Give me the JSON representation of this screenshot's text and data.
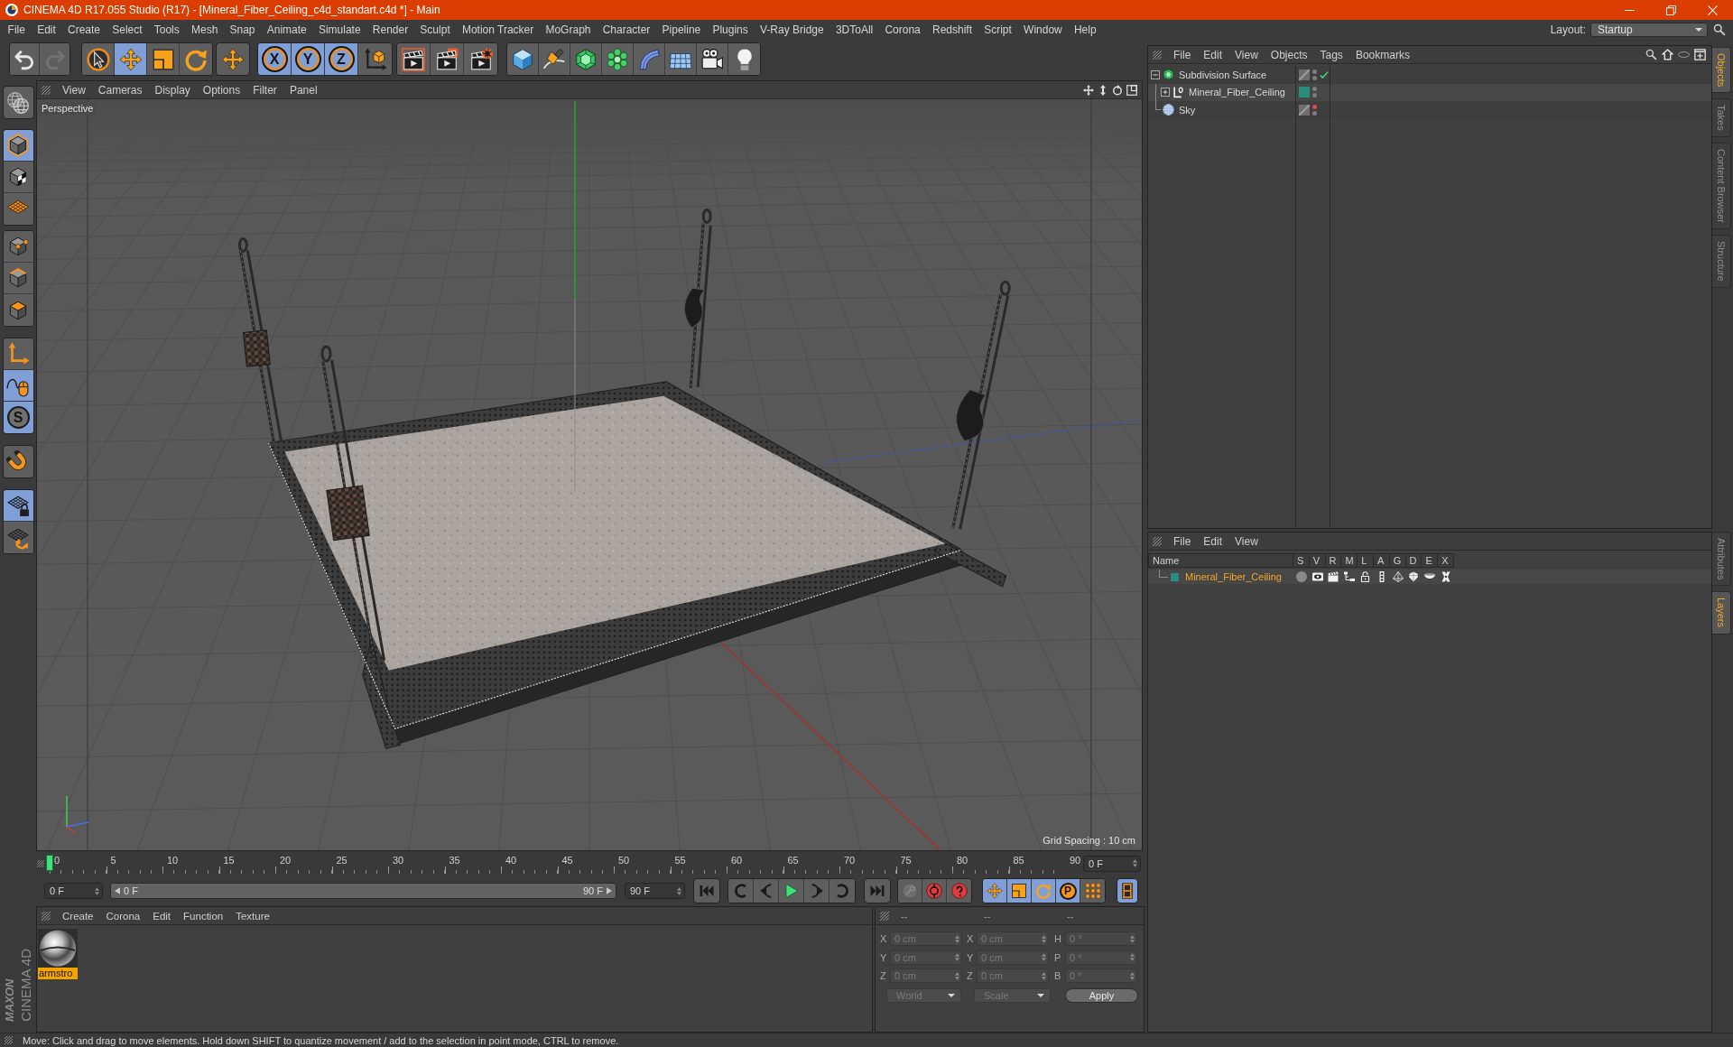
{
  "window": {
    "title": "CINEMA 4D R17.055 Studio (R17) - [Mineral_Fiber_Ceiling_c4d_standart.c4d *] - Main"
  },
  "menu": [
    "File",
    "Edit",
    "Create",
    "Select",
    "Tools",
    "Mesh",
    "Snap",
    "Animate",
    "Simulate",
    "Render",
    "Sculpt",
    "Motion Tracker",
    "MoGraph",
    "Character",
    "Pipeline",
    "Plugins",
    "V-Ray Bridge",
    "3DToAll",
    "Corona",
    "Redshift",
    "Script",
    "Window",
    "Help"
  ],
  "layout": {
    "label": "Layout:",
    "value": "Startup"
  },
  "toolbar": {
    "history": [
      {
        "disabled": false
      },
      {
        "disabled": true
      }
    ],
    "tools": [
      {
        "selected": false
      },
      {
        "selected": true
      },
      {
        "selected": false
      },
      {
        "selected": false
      },
      {
        "selected": false
      }
    ],
    "axis_locks": [
      {
        "label": "X",
        "selected": true
      },
      {
        "label": "Y",
        "selected": true
      },
      {
        "label": "Z",
        "selected": true
      }
    ],
    "world_coordinates": {
      "selected": false
    }
  },
  "modes": [
    [
      {
        "selected": false
      }
    ],
    [
      {
        "selected": true
      },
      {
        "selected": false
      },
      {
        "selected": false
      }
    ],
    [
      {
        "selected": false
      },
      {
        "selected": false
      },
      {
        "selected": false
      }
    ],
    [
      {
        "selected": false
      },
      {
        "selected": true
      },
      {
        "label": "S",
        "selected": true
      }
    ],
    [
      {
        "selected": false
      }
    ],
    [
      {
        "selected": true
      },
      {
        "selected": false
      }
    ]
  ],
  "viewport": {
    "menu": [
      "View",
      "Cameras",
      "Display",
      "Options",
      "Filter",
      "Panel"
    ],
    "camera": "Perspective",
    "grid_spacing": "Grid Spacing : 10 cm"
  },
  "timeline": {
    "ticks": [
      "0",
      "5",
      "10",
      "15",
      "20",
      "25",
      "30",
      "35",
      "40",
      "45",
      "50",
      "55",
      "60",
      "65",
      "70",
      "75",
      "80",
      "85",
      "90"
    ],
    "playhead": {
      "level": 0
    },
    "current_frame": "0 F"
  },
  "transport": {
    "start": "0 F",
    "range": [
      {
        "label": "0 F",
        "level": 0
      },
      {
        "label": "90 F",
        "level": 1
      }
    ],
    "end": "90 F",
    "keys": [
      {
        "disabled": true
      },
      {
        "disabled": false
      },
      {
        "disabled": false
      }
    ],
    "tracks": [
      {
        "selected": true
      },
      {
        "selected": true
      },
      {
        "selected": true
      },
      {
        "label": "P",
        "selected": true
      },
      {
        "selected": false
      }
    ],
    "timeline_toggle": {
      "selected": true
    }
  },
  "materials": {
    "menu": [
      "Create",
      "Corona",
      "Edit",
      "Function",
      "Texture"
    ],
    "items": [
      {
        "name": "armstro",
        "selected": true
      }
    ]
  },
  "logo": {
    "brand": "MAXON",
    "product": "CINEMA 4D"
  },
  "coordinates": {
    "headers": [
      "--",
      "--",
      "--"
    ],
    "disabled": true,
    "rows": [
      {
        "axis": "X",
        "position": "0 cm",
        "size_axis": "X",
        "size": "0 cm",
        "rotation_axis": "H",
        "rotation": "0 °"
      },
      {
        "axis": "Y",
        "position": "0 cm",
        "size_axis": "Y",
        "size": "0 cm",
        "rotation_axis": "P",
        "rotation": "0 °"
      },
      {
        "axis": "Z",
        "position": "0 cm",
        "size_axis": "Z",
        "size": "0 cm",
        "rotation_axis": "B",
        "rotation": "0 °"
      }
    ],
    "mode": "World",
    "size_mode": "Scale",
    "apply": "Apply"
  },
  "objects": {
    "menu": [
      "File",
      "Edit",
      "View",
      "Objects",
      "Tags",
      "Bookmarks"
    ],
    "items": [
      {
        "name": "Subdivision Surface",
        "kind": "subdivision",
        "expanded": true,
        "editor_visible": true,
        "render_visible": true,
        "enabled": true,
        "children": [
          {
            "name": "Mineral_Fiber_Ceiling",
            "kind": "null",
            "expanded": false,
            "color": "#2a8c7c",
            "editor_visible": true,
            "render_visible": true
          }
        ]
      },
      {
        "name": "Sky",
        "kind": "sky",
        "editor_visible": false,
        "render_visible": true
      }
    ]
  },
  "layers": {
    "menu": [
      "File",
      "Edit",
      "View"
    ],
    "columns": [
      "Name",
      "S",
      "V",
      "R",
      "M",
      "L",
      "A",
      "G",
      "D",
      "E",
      "X"
    ],
    "rows": [
      {
        "name": "Mineral_Fiber_Ceiling",
        "color": "#2a8c7c",
        "selected": true,
        "flags": [
          {
            "on": false
          },
          {
            "on": true
          },
          {
            "on": true
          },
          {
            "on": true
          },
          {
            "on": true
          },
          {
            "on": true
          },
          {
            "on": true
          },
          {
            "on": true
          },
          {
            "on": true
          },
          {
            "on": true
          }
        ]
      }
    ]
  },
  "side_tabs": {
    "top": [
      {
        "label": "Objects",
        "selected": true
      },
      {
        "label": "Takes",
        "selected": false
      },
      {
        "label": "Content Browser",
        "selected": false
      },
      {
        "label": "Structure",
        "selected": false
      }
    ],
    "bottom": [
      {
        "label": "Attributes",
        "selected": false
      },
      {
        "label": "Layers",
        "selected": true
      }
    ]
  },
  "status": "Move: Click and drag to move elements. Hold down SHIFT to quantize movement / add to the selection in point mode, CTRL to remove."
}
